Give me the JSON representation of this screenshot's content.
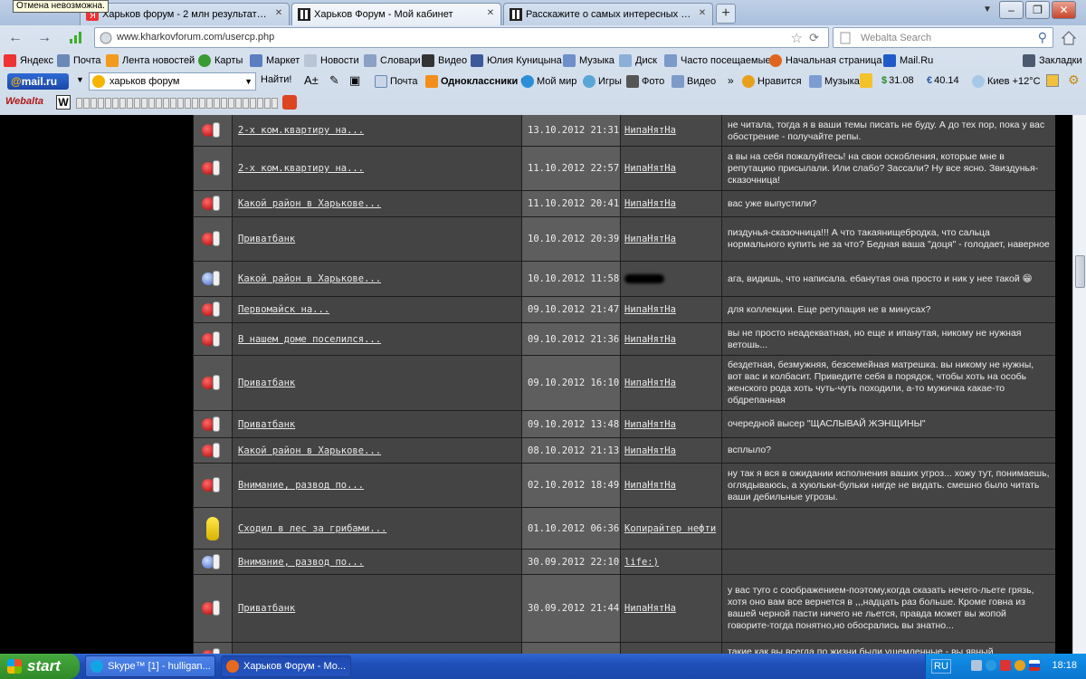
{
  "tooltip": "Отмена невозможна.",
  "tabs": [
    {
      "label": "Харьков форум - 2 млн результатов. П...",
      "active": false
    },
    {
      "label": "Харьков Форум - Мой кабинет",
      "active": true
    },
    {
      "label": "Расскажите о самых интересных или н...",
      "active": false
    }
  ],
  "window_buttons": {
    "min": "–",
    "max": "❐",
    "close": "✕"
  },
  "address": {
    "url": "www.kharkovforum.com/usercp.php"
  },
  "search": {
    "placeholder": "Webalta Search"
  },
  "bookmarks": [
    "Яндекс",
    "Почта",
    "Лента новостей",
    "Карты",
    "Маркет",
    "Новости",
    "Словари",
    "Видео",
    "Юлия Куницына",
    "Музыка",
    "Диск",
    "Часто посещаемые",
    "Начальная страница",
    "Mail.Ru"
  ],
  "bookmarks_menu": "Закладки",
  "mailru_toolbar": {
    "logo_at": "@",
    "logo": "mail.ru",
    "search_value": "харьков форум",
    "find_label": "Найти!",
    "items": [
      "Почта",
      "Одноклассники 6",
      "Мой мир",
      "Игры",
      "Фото",
      "Видео"
    ],
    "more": "»",
    "right_items": [
      "Нравится",
      "Музыка",
      "31.08",
      "40.14",
      "Киев +12°C"
    ],
    "currency_usd": "$",
    "currency_eur": "€"
  },
  "webalta_toolbar": {
    "logo": "Webalta",
    "w": "W"
  },
  "rows": [
    {
      "icon": "negative",
      "thread": "2-х ком.квартиру на...",
      "date": "13.10.2012 21:31",
      "user": "НипаНятНа",
      "comment": "не читала, тогда я в ваши темы писать не буду. А до тех пор, пока у вас обострение - получайте репы."
    },
    {
      "icon": "negative",
      "thread": "2-х ком.квартиру на...",
      "date": "11.10.2012 22:57",
      "user": "НипаНятНа",
      "comment": "а вы на себя пожалуйтесь! на свои оскобления, которые мне в репутацию присылали. Или слабо? Зассали? Ну все ясно. Звиздунья-сказочница!"
    },
    {
      "icon": "negative",
      "thread": "Какой район в Харькове...",
      "date": "11.10.2012 20:41",
      "user": "НипаНятНа",
      "comment": "вас уже выпустили?"
    },
    {
      "icon": "negative",
      "thread": "Приватбанк",
      "date": "10.10.2012 20:39",
      "user": "НипаНятНа",
      "comment": "пиздунья-сказочница!!! А что такаянищебродка, что сальца нормального купить не за что? Бедная ваша \"доця\" - голодает, наверное"
    },
    {
      "icon": "positive",
      "thread": "Какой район в Харькове...",
      "date": "10.10.2012 11:58",
      "user": "",
      "comment": "ага, видишь, что написала. ебанутая она просто и ник у нее такой 😁"
    },
    {
      "icon": "negative",
      "thread": "Первомайск на...",
      "date": "09.10.2012 21:47",
      "user": "НипаНятНа",
      "comment": "для коллекции. Еще ретупация не в минусах?"
    },
    {
      "icon": "negative",
      "thread": "В нашем доме поселился...",
      "date": "09.10.2012 21:36",
      "user": "НипаНятНа",
      "comment": "вы не просто неадекватная, но еще и ипанутая, никому не нужная ветошь..."
    },
    {
      "icon": "negative",
      "thread": "Приватбанк",
      "date": "09.10.2012 16:10",
      "user": "НипаНятНа",
      "comment": "бездетная, безмужняя, безсемейная матрешка. вы никому не нужны, вот вас и колбасит. Приведите себя в порядок, чтобы хоть на особь женского рода хоть чуть-чуть походили, а-то мужичка какае-то обдрепанная"
    },
    {
      "icon": "negative",
      "thread": "Приватбанк",
      "date": "09.10.2012 13:48",
      "user": "НипаНятНа",
      "comment": "очередной высер \"ЩАСЛЫВАЙ ЖЭНЩИНЫ\""
    },
    {
      "icon": "negative",
      "thread": "Какой район в Харькове...",
      "date": "08.10.2012 21:13",
      "user": "НипаНятНа",
      "comment": "всплыло?"
    },
    {
      "icon": "negative",
      "thread": "Внимание, развод по...",
      "date": "02.10.2012 18:49",
      "user": "НипаНятНа",
      "comment": "ну так я вся в ожидании исполнения ваших угроз... хожу тут, понимаешь, оглядываюсь, а хуюльки-бульки нигде не видать. смешно было читать ваши дебильные угрозы."
    },
    {
      "icon": "banana",
      "thread": "Сходил в лес за грибами...",
      "date": "01.10.2012 06:36",
      "user": "Копирайтер нефти",
      "comment": ""
    },
    {
      "icon": "positive",
      "thread": "Внимание, развод по...",
      "date": "30.09.2012 22:10",
      "user": "life:)",
      "comment": ""
    },
    {
      "icon": "negative",
      "thread": "Приватбанк",
      "date": "30.09.2012 21:44",
      "user": "НипаНятНа",
      "comment": "у вас туго с соображением-поэтому,когда сказать нечего-льете грязь, хотя оно вам все вернется в ,,,надцать раз больше. Кроме говна из вашей черной пасти ничего не льется, правда может вы жопой говорите-тогда понятно,но обосрались вы знатно..."
    },
    {
      "icon": "negative",
      "thread": "",
      "date": "",
      "user": "",
      "comment": "такие как вы всегда по жизни были ущемленные - вы явный"
    }
  ],
  "taskbar": {
    "start": "start",
    "tasks": [
      {
        "label": "Skype™ [1] - hulligan..."
      },
      {
        "label": "Харьков Форум - Мо..."
      }
    ],
    "lang": "RU",
    "clock": "18:18"
  },
  "colors": {
    "table_bg": "#3b3b3b",
    "date_cell": "#5e5e5e",
    "taskbar": "#245edb",
    "start_green": "#3a9a33"
  }
}
